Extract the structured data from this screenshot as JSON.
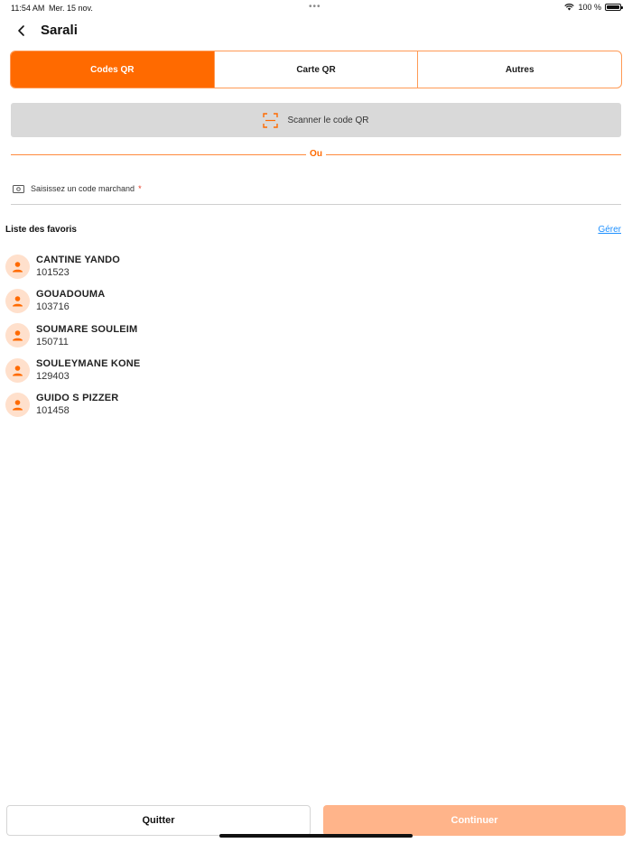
{
  "status_bar": {
    "time": "11:54 AM",
    "date": "Mer. 15 nov.",
    "battery_text": "100 %",
    "battery_level": 1.0
  },
  "header": {
    "title": "Sarali",
    "back_icon": "chevron-left-icon"
  },
  "tabs": [
    {
      "label": "Codes QR",
      "active": true
    },
    {
      "label": "Carte QR",
      "active": false
    },
    {
      "label": "Autres",
      "active": false
    }
  ],
  "scan": {
    "label": "Scanner le code QR",
    "icon": "qr-scan-icon"
  },
  "divider": {
    "text": "Ou"
  },
  "merchant": {
    "label": "Saisissez un code marchand",
    "required_mark": "*",
    "value": "",
    "icon": "banknote-icon"
  },
  "favorites": {
    "title": "Liste des favoris",
    "manage_label": "Gérer",
    "items": [
      {
        "name": "CANTINE YANDO",
        "code": "101523"
      },
      {
        "name": "GOUADOUMA",
        "code": "103716"
      },
      {
        "name": "SOUMARE SOULEIM",
        "code": "150711"
      },
      {
        "name": "SOULEYMANE KONE",
        "code": "129403"
      },
      {
        "name": "GUIDO S PIZZER",
        "code": "101458"
      }
    ]
  },
  "actions": {
    "quit_label": "Quitter",
    "continue_label": "Continuer",
    "continue_enabled": false
  },
  "colors": {
    "accent": "#ff6a00",
    "accent_light": "#ffb48a",
    "avatar_bg": "#ffe0cc",
    "link": "#1e90ff"
  }
}
